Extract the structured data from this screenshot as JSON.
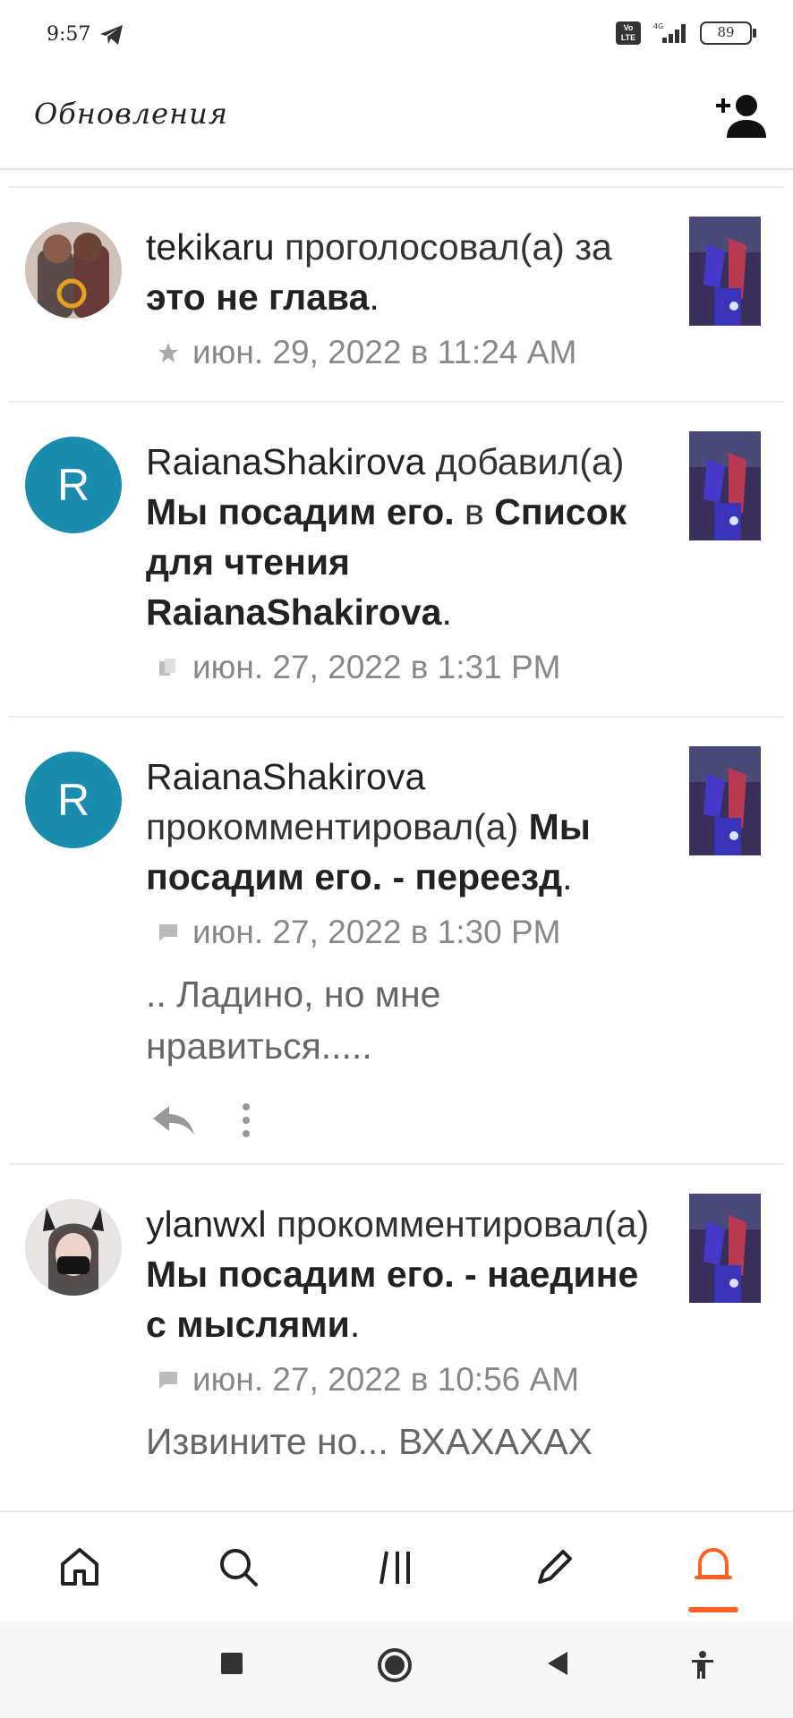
{
  "status_bar": {
    "time": "9:57",
    "network": "4G",
    "volte": "Vo LTE",
    "battery": "89"
  },
  "app_bar": {
    "title": "Обновления"
  },
  "feed": [
    {
      "user": "tekikaru",
      "action": " проголосовал(а) за ",
      "story": "это не глава",
      "suffix": ".",
      "meta_icon": "star-icon",
      "timestamp": "июн. 29, 2022 в 11:24 AM"
    },
    {
      "user": "RaianaShakirova",
      "avatar_letter": "R",
      "action": " добавил(а) ",
      "story": "Мы посадим его.",
      "action2": " в ",
      "story2": "Список для чтения RaianaShakirova",
      "suffix": ".",
      "meta_icon": "reading-list-icon",
      "timestamp": "июн. 27, 2022 в 1:31 PM"
    },
    {
      "user": "RaianaShakirova",
      "avatar_letter": "R",
      "action": " прокомментировал(а) ",
      "story": "Мы посадим его. - переезд",
      "suffix": ".",
      "meta_icon": "comment-icon",
      "timestamp": "июн. 27, 2022 в 1:30 PM",
      "comment": "..  Ладино, но мне нравиться....."
    },
    {
      "user": "ylanwxl",
      "action": " прокомментировал(а) ",
      "story": "Мы посадим его. - наедине с мыслями",
      "suffix": ".",
      "meta_icon": "comment-icon",
      "timestamp": "июн. 27, 2022 в 10:56 AM",
      "comment": "Извините но... ВХАХАХАХ"
    }
  ],
  "bottom_nav": [
    "home-icon",
    "search-icon",
    "library-icon",
    "write-icon",
    "notifications-icon"
  ],
  "colors": {
    "accent": "#ff6122",
    "avatar_bg": "#1a8cad"
  }
}
